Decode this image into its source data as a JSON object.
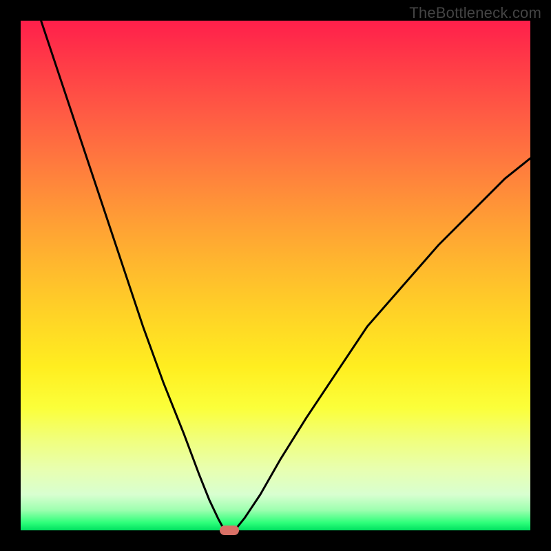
{
  "watermark": "TheBottleneck.com",
  "chart_data": {
    "type": "line",
    "title": "",
    "xlabel": "",
    "ylabel": "",
    "xlim": [
      0,
      100
    ],
    "ylim": [
      0,
      100
    ],
    "background_gradient": {
      "top": "#ff1f4b",
      "mid": "#ffee20",
      "bottom": "#00e060"
    },
    "series": [
      {
        "name": "left-branch",
        "x": [
          4,
          8,
          12,
          16,
          20,
          24,
          28,
          32,
          35,
          37,
          38.8,
          40
        ],
        "y": [
          100,
          88,
          76,
          64,
          52,
          40,
          29,
          19,
          11,
          6,
          2.2,
          0
        ]
      },
      {
        "name": "right-branch",
        "x": [
          42,
          44,
          47,
          51,
          56,
          62,
          68,
          75,
          82,
          89,
          95,
          100
        ],
        "y": [
          0,
          2.5,
          7,
          14,
          22,
          31,
          40,
          48,
          56,
          63,
          69,
          73
        ]
      }
    ],
    "marker": {
      "name": "bottleneck-marker",
      "x": 41,
      "y": 0,
      "color": "#d97066"
    },
    "annotations": []
  }
}
